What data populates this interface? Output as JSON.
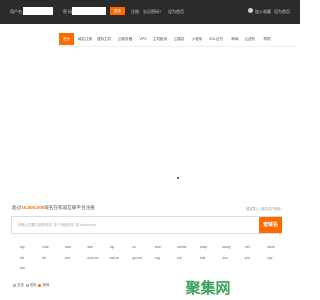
{
  "topbar": {
    "user_label": "用户名",
    "pass_label": "密 码",
    "login_button": "登录",
    "register": "注册",
    "forgot": "忘记密码?",
    "right_link1": "加入收藏",
    "right_link2": "设为首页",
    "icon": "user-icon"
  },
  "nav": {
    "items": [
      "首页",
      "域名注册",
      "虚拟主机",
      "云服务器",
      "VPS",
      "主机租用",
      "云建站",
      "小程序",
      "SSL证书",
      "邮局",
      "云虚机",
      "帮助"
    ],
    "active_index": 0,
    "accent": "#ff6a00"
  },
  "promo": {
    "prefix": "超过",
    "highlight": "10,000,000",
    "suffix": "域名在和诚互联平台注册",
    "links": "域名导入 | 域名过户查询"
  },
  "search": {
    "placeholder": "请输入您要注册的域名, 多个请用回车 如: baidu.com",
    "button": "查域名"
  },
  "tlds": [
    [
      ".top",
      ".club",
      ".com",
      ".site",
      ".vip",
      ".cn",
      ".tech",
      ".online",
      ".shop",
      ".wang",
      ".net",
      ".store"
    ],
    [
      ".biz",
      ".ltd",
      ".red",
      ".com.cn",
      ".net.cn",
      ".gov.cn",
      ".org",
      ".ink",
      ".info",
      ".kim",
      ".pro",
      ".xyz"
    ],
    [
      ".win"
    ]
  ],
  "options": {
    "all": "全选",
    "common": "常用",
    "recommend": "推荐"
  },
  "brand": "聚集网"
}
